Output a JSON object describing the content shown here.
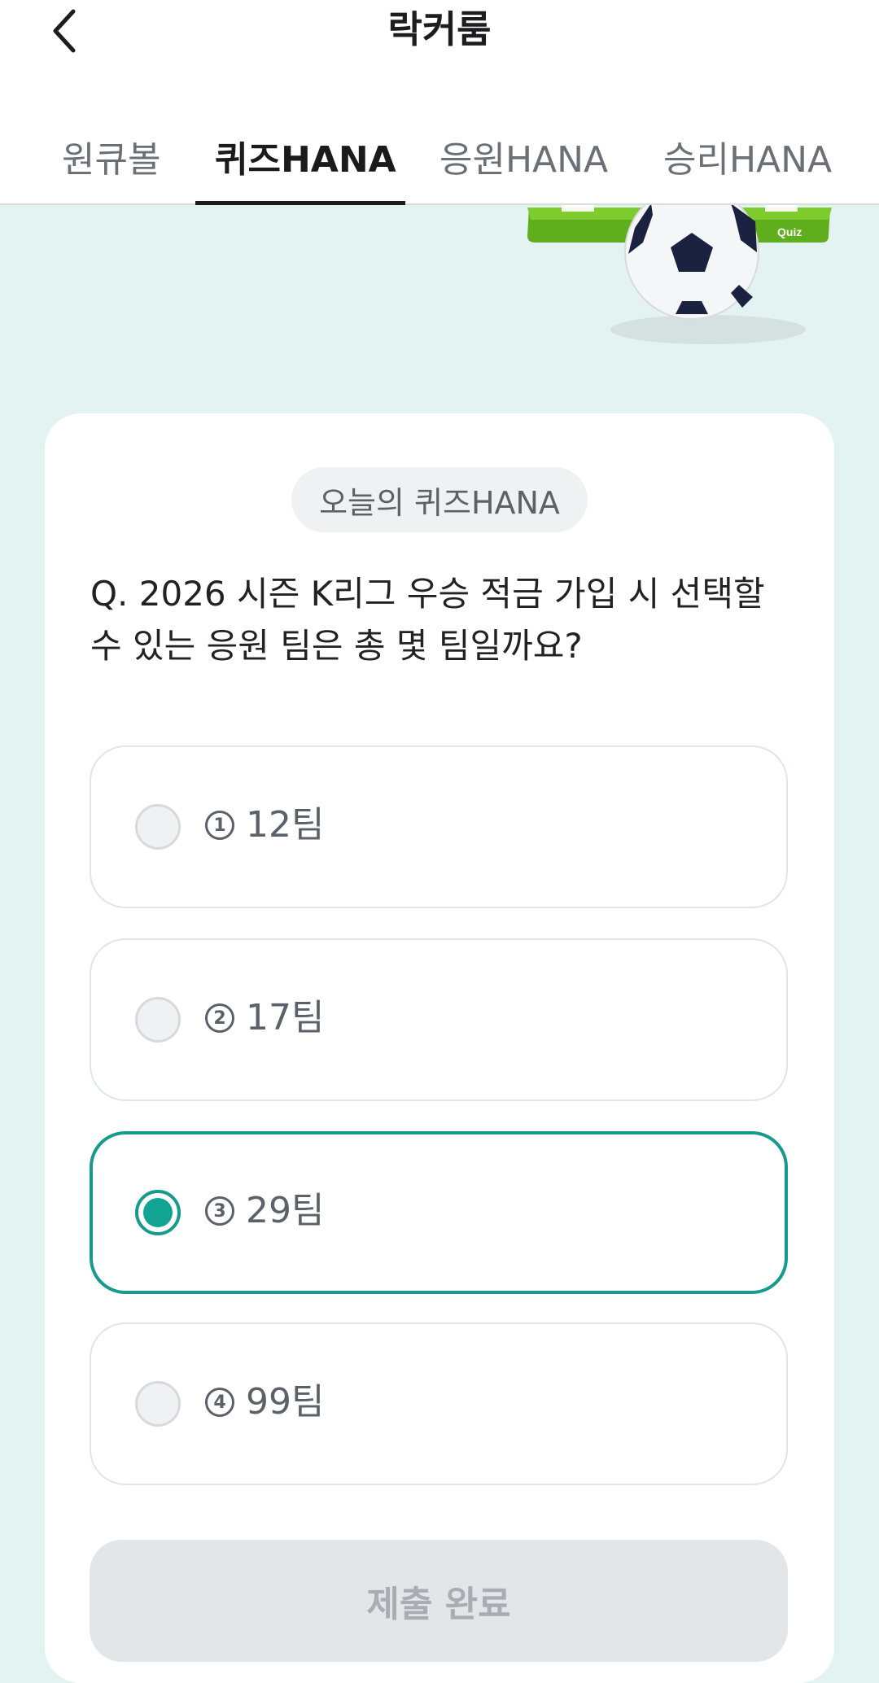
{
  "header": {
    "title": "락커룸",
    "back_icon": "chevron-left-icon"
  },
  "tabs": [
    {
      "label": "원큐볼",
      "active": false
    },
    {
      "label": "퀴즈HANA",
      "active": true
    },
    {
      "label": "응원HANA",
      "active": false
    },
    {
      "label": "승리HANA",
      "active": false
    }
  ],
  "hero": {
    "illustration_label": "Quiz"
  },
  "quiz": {
    "badge": "오늘의 퀴즈HANA",
    "question": "Q. 2026 시즌 K리그 우승 적금 가입 시 선택할 수 있는 응원 팀은 총 몇 팀일까요?",
    "options": [
      {
        "num": "1",
        "text": "12팀",
        "selected": false
      },
      {
        "num": "2",
        "text": "17팀",
        "selected": false
      },
      {
        "num": "3",
        "text": "29팀",
        "selected": true
      },
      {
        "num": "4",
        "text": "99팀",
        "selected": false
      }
    ],
    "submit_label": "제출 완료"
  },
  "colors": {
    "accent": "#159a8c",
    "background": "#e3f3f1",
    "disabled_button": "#e3e6e9"
  }
}
